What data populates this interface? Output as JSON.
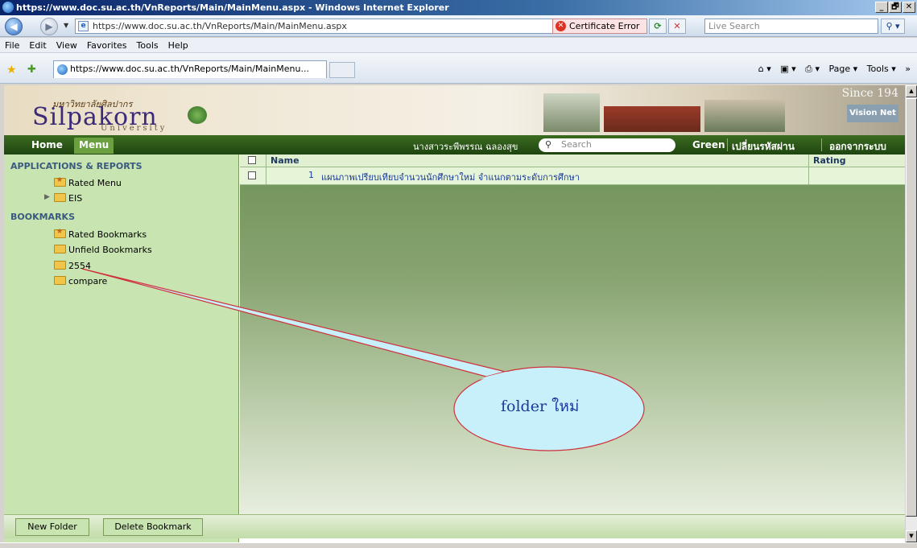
{
  "window": {
    "title": "https://www.doc.su.ac.th/VnReports/Main/MainMenu.aspx - Windows Internet Explorer",
    "buttons": [
      "_",
      "🗗",
      "✕"
    ]
  },
  "address_bar": {
    "url": "https://www.doc.su.ac.th/VnReports/Main/MainMenu.aspx",
    "cert_error": "Certificate Error",
    "search_placeholder": "Live Search"
  },
  "menu_bar": [
    "File",
    "Edit",
    "View",
    "Favorites",
    "Tools",
    "Help"
  ],
  "fav_bar": {
    "tab_title": "https://www.doc.su.ac.th/VnReports/Main/MainMenu...",
    "commands": [
      "Page ▾",
      "Tools ▾"
    ]
  },
  "banner": {
    "thai_name": "มหาวิทยาลัยศิลปากร",
    "name": "Silpakorn",
    "sub": "University",
    "since": "Since 194",
    "vision": "Vision Net"
  },
  "nav": {
    "home": "Home",
    "menu": "Menu",
    "user": "นางสาวระพีพรรณ ฉลองสุข",
    "search_placeholder": "Search",
    "green": "Green",
    "change_password": "เปลี่ยนรหัสผ่าน",
    "logout": "ออกจากระบบ"
  },
  "left_pane": {
    "apps_header": "APPLICATIONS & REPORTS",
    "apps_items": [
      "Rated Menu",
      "EIS"
    ],
    "bookmarks_header": "BOOKMARKS",
    "bookmark_items": [
      "Rated Bookmarks",
      "Unfield Bookmarks",
      "2554",
      "compare"
    ]
  },
  "table": {
    "col_name": "Name",
    "col_rating": "Rating",
    "rows": [
      {
        "num": "1",
        "name": "แผนภาพเปรียบเทียบจำนวนนักศึกษาใหม่ จำแนกตามระดับการศึกษา",
        "rating": ""
      }
    ]
  },
  "bottom_buttons": {
    "new_folder": "New Folder",
    "delete_bookmark": "Delete Bookmark"
  },
  "callout": {
    "text": "folder ใหม่"
  }
}
